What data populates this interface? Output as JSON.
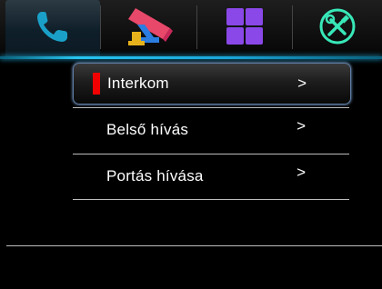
{
  "tabs": [
    {
      "icon": "phone-icon",
      "selected": true
    },
    {
      "icon": "security-camera-icon",
      "selected": false
    },
    {
      "icon": "apps-grid-icon",
      "selected": false
    },
    {
      "icon": "tools-settings-icon",
      "selected": false
    }
  ],
  "colors": {
    "accent": "#27c6f0",
    "selected_marker": "#f20000",
    "phone_icon": "#1aa0c8",
    "grid_icon": "#8a48e8",
    "tools_icon": "#38e8b8"
  },
  "menu": {
    "items": [
      {
        "label": "Interkom",
        "arrow": ">",
        "selected": true
      },
      {
        "label": "Belső hívás",
        "arrow": ">",
        "selected": false
      },
      {
        "label": "Portás hívása",
        "arrow": ">",
        "selected": false
      }
    ]
  }
}
